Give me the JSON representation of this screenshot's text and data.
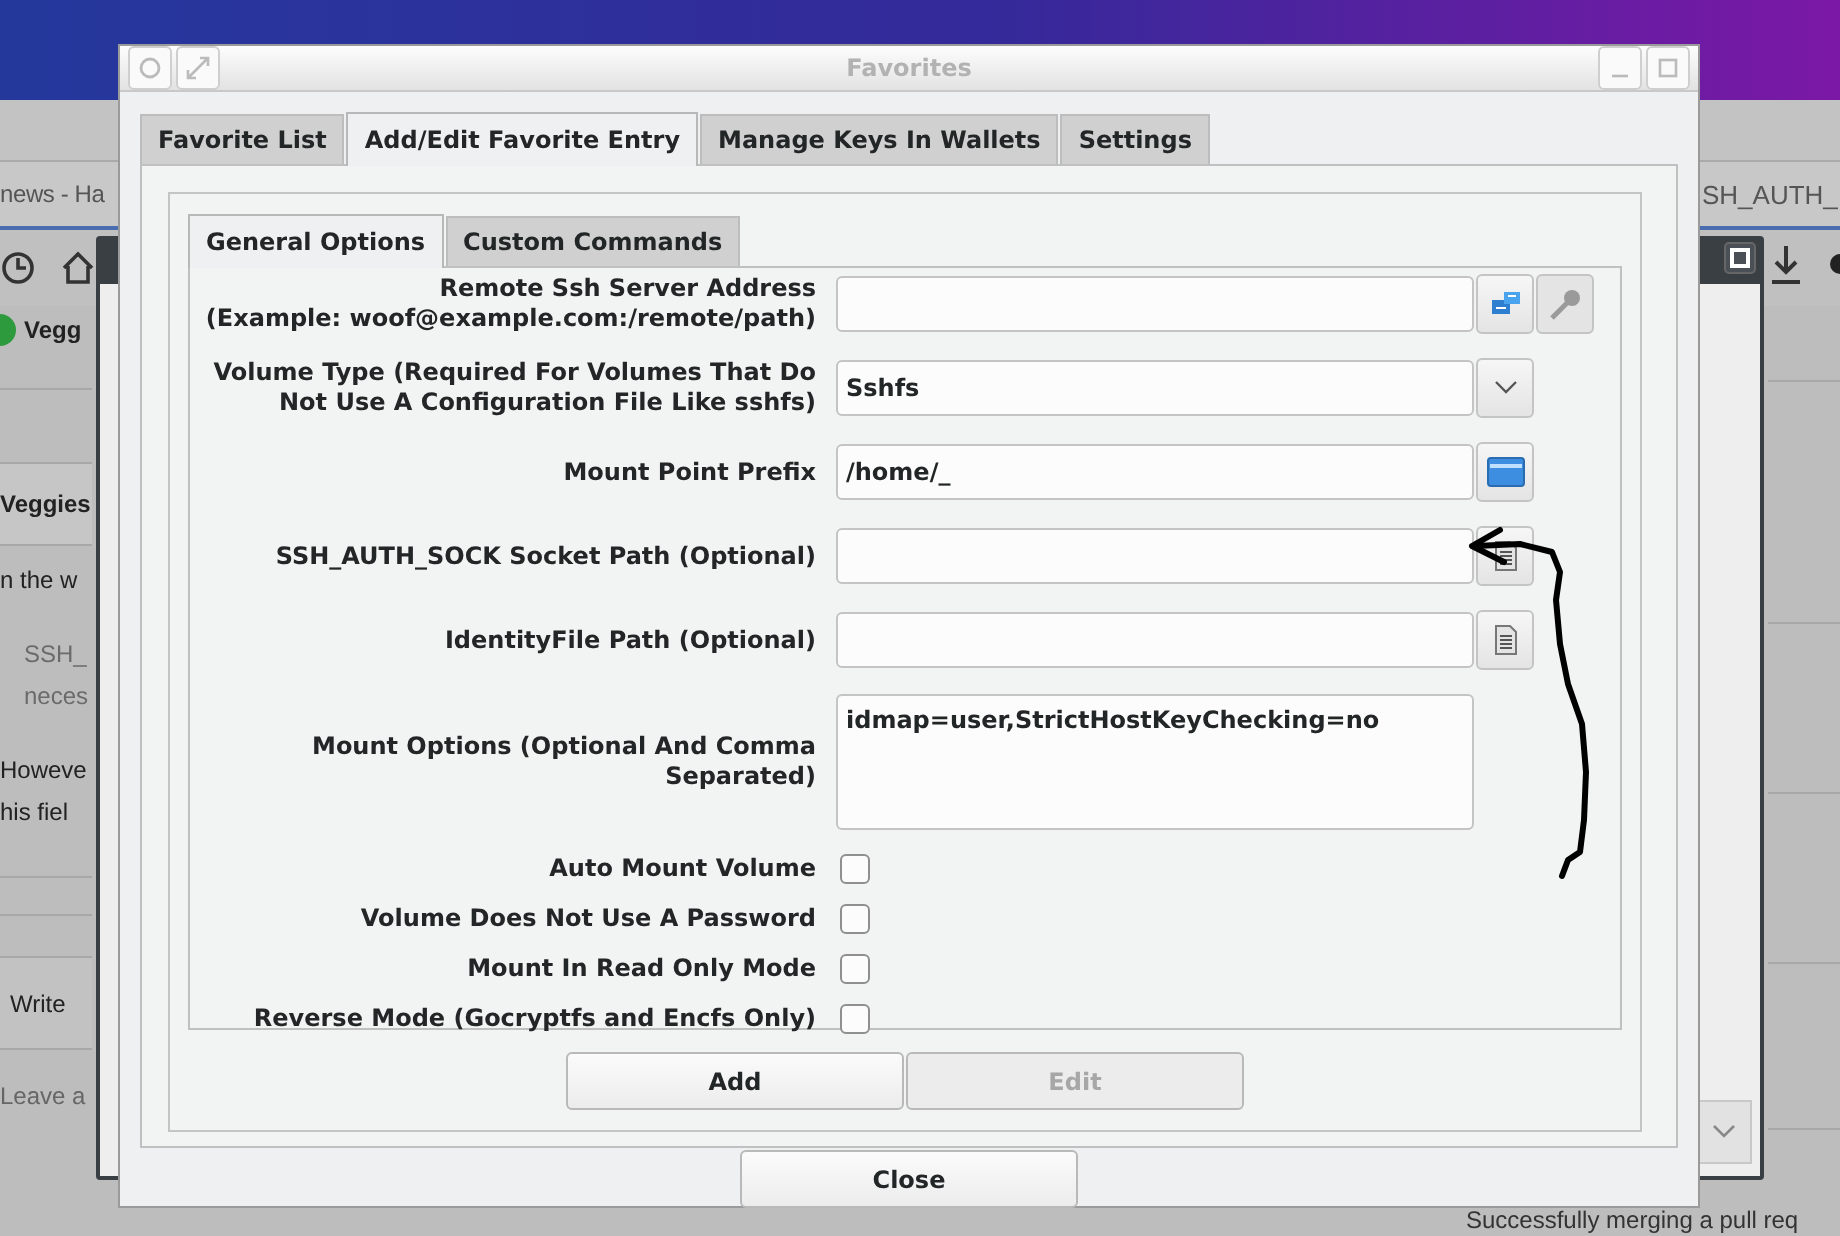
{
  "background": {
    "page_title": "news - Ha",
    "side_title": "SH_AUTH_",
    "author": "Vegg",
    "heading": "Veggies",
    "lines": [
      {
        "text": "n the w",
        "kind": "plain"
      },
      {
        "text": "SSH_",
        "kind": "quote"
      },
      {
        "text": "neces",
        "kind": "quote"
      },
      {
        "text": "Howeve",
        "kind": "plain"
      },
      {
        "text": "his fiel",
        "kind": "plain"
      }
    ],
    "write_tab": "Write",
    "comment_placeholder": "Leave a",
    "merge_note": "Successfully merging a pull req"
  },
  "window": {
    "title": "Favorites"
  },
  "tabs": [
    {
      "label": "Favorite List",
      "selected": false
    },
    {
      "label": "Add/Edit Favorite Entry",
      "selected": true
    },
    {
      "label": "Manage Keys In Wallets",
      "selected": false
    },
    {
      "label": "Settings",
      "selected": false
    }
  ],
  "subtabs": [
    {
      "label": "General Options",
      "selected": true
    },
    {
      "label": "Custom Commands",
      "selected": false
    }
  ],
  "fields": [
    {
      "kind": "address",
      "label": "Remote Ssh Server Address\n(Example: woof@example.com:/remote/path)"
    },
    {
      "kind": "combo",
      "label": "Volume Type (Required For Volumes That Do Not Use A Configuration File Like sshfs)",
      "value": "Sshfs"
    },
    {
      "kind": "folder",
      "label": "Mount Point Prefix",
      "value": "/home/_"
    },
    {
      "kind": "file",
      "label": "SSH_AUTH_SOCK Socket Path (Optional)"
    },
    {
      "kind": "file",
      "label": "IdentityFile Path (Optional)"
    },
    {
      "kind": "textarea",
      "label": "Mount Options (Optional And Comma Separated)",
      "value": "idmap=user,StrictHostKeyChecking=no"
    }
  ],
  "checkboxes": [
    {
      "label": "Auto Mount Volume",
      "checked": false
    },
    {
      "label": "Volume Does Not Use A Password",
      "checked": false
    },
    {
      "label": "Mount In Read Only Mode",
      "checked": false
    },
    {
      "label": "Reverse Mode (Gocryptfs and Encfs Only)",
      "checked": false
    }
  ],
  "buttons": [
    {
      "label": "Add",
      "disabled": false
    },
    {
      "label": "Edit",
      "disabled": true
    }
  ],
  "close_button": "Close"
}
